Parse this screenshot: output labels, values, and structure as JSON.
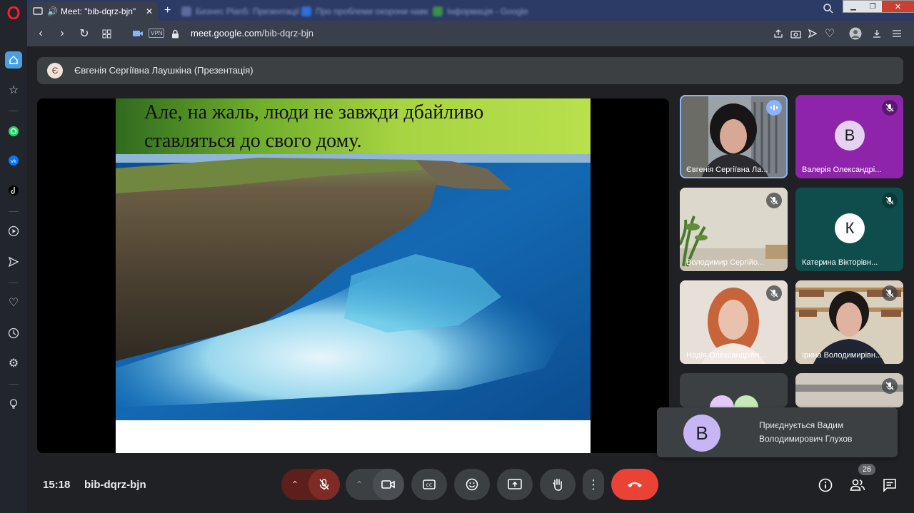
{
  "browser": {
    "tabs": [
      {
        "title": "Meet: \"bib-dqrz-bjn\"",
        "active": true
      },
      {
        "title": "Бизнес Plan5: Презентації",
        "active": false
      },
      {
        "title": "Про проблеми охорони навколишнього",
        "active": false
      },
      {
        "title": "Інформація - Google",
        "active": false
      }
    ],
    "url_domain": "meet.google.com",
    "url_path": "/bib-dqrz-bjn",
    "vpn_label": "VPN"
  },
  "meet": {
    "presenter_initial": "Є",
    "presenter_label": "Євгенія Сергіївна Лаушкіна (Презентація)",
    "slide_text": "Але, на жаль, люди не завжди дбайливо ставляться до свого дому.",
    "participants": [
      {
        "name": "Євгенія Сергіївна Ла...",
        "initial": "",
        "muted": false,
        "speaking": true
      },
      {
        "name": "Валерія Олександрі...",
        "initial": "В",
        "muted": true,
        "avatar_color": "#c7b6f5",
        "tile_color": "#8e24aa"
      },
      {
        "name": "Володимир Сергійо...",
        "initial": "",
        "muted": true
      },
      {
        "name": "Катерина Вікторівн...",
        "initial": "К",
        "muted": true,
        "avatar_color": "#ffffff",
        "tile_color": "#0f4c4c"
      },
      {
        "name": "Надія Олександрівн...",
        "initial": "",
        "muted": true
      },
      {
        "name": "Ірина Володимирівн...",
        "initial": "",
        "muted": true
      },
      {
        "name": "",
        "initial": "",
        "muted": false
      },
      {
        "name": "",
        "initial": "",
        "muted": true
      }
    ],
    "join_toast": {
      "initial": "В",
      "text": "Приєднується Вадим Володимирович Глухов"
    },
    "time": "15:18",
    "meeting_code": "bib-dqrz-bjn",
    "people_count": "26"
  },
  "colors": {
    "end_call": "#ea4335",
    "control_bg": "#3c4043",
    "page_bg": "#202124"
  }
}
